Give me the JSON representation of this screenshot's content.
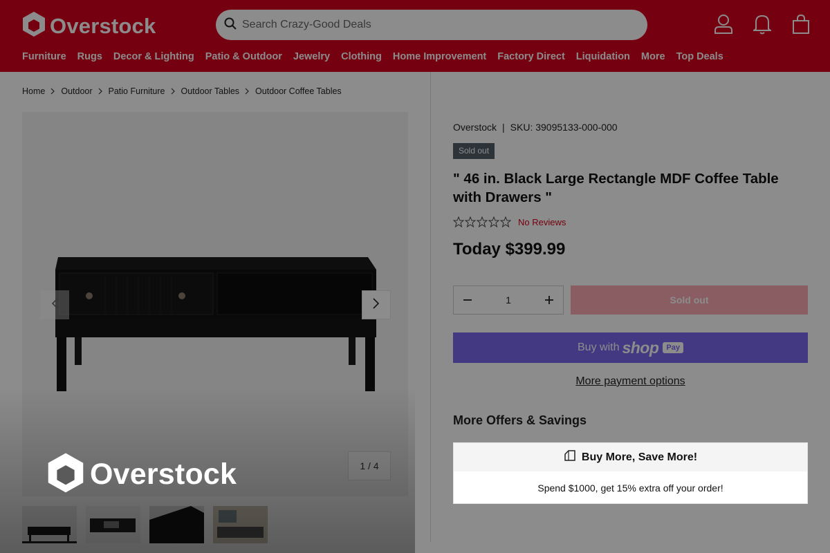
{
  "header": {
    "logo_text": "Overstock",
    "search_placeholder": "Search Crazy-Good Deals",
    "nav": [
      "Furniture",
      "Rugs",
      "Decor & Lighting",
      "Patio & Outdoor",
      "Jewelry",
      "Clothing",
      "Home Improvement",
      "Factory Direct",
      "Liquidation",
      "More",
      "Top Deals"
    ],
    "icons": [
      "account-icon",
      "bell-icon",
      "shopping-bag-icon"
    ]
  },
  "breadcrumb": [
    "Home",
    "Outdoor",
    "Patio Furniture",
    "Outdoor Tables",
    "Outdoor Coffee Tables"
  ],
  "gallery": {
    "counter": "1 / 4",
    "overlay_logo_text": "Overstock"
  },
  "product": {
    "vendor": "Overstock",
    "separator": "|",
    "sku": "SKU: 39095133-000-000",
    "badge": "Sold out",
    "title": "\" 46 in. Black Large Rectangle MDF Coffee Table with Drawers \"",
    "rating": 0,
    "reviews_label": "No Reviews",
    "price": "Today $399.99",
    "quantity": "1",
    "soldout_button": "Sold out",
    "shop_pre": "Buy with",
    "shop_word": "shop",
    "shop_pay": "Pay",
    "more_payment": "More payment options"
  },
  "offers": {
    "title": "More Offers & Savings",
    "card_title": "Buy More, Save More!",
    "card_body": "Spend $1000, get 15% extra off your order!"
  },
  "colors": {
    "brand": "#d6001c",
    "shop_pay": "#7b68ee",
    "badge": "#50606a"
  }
}
